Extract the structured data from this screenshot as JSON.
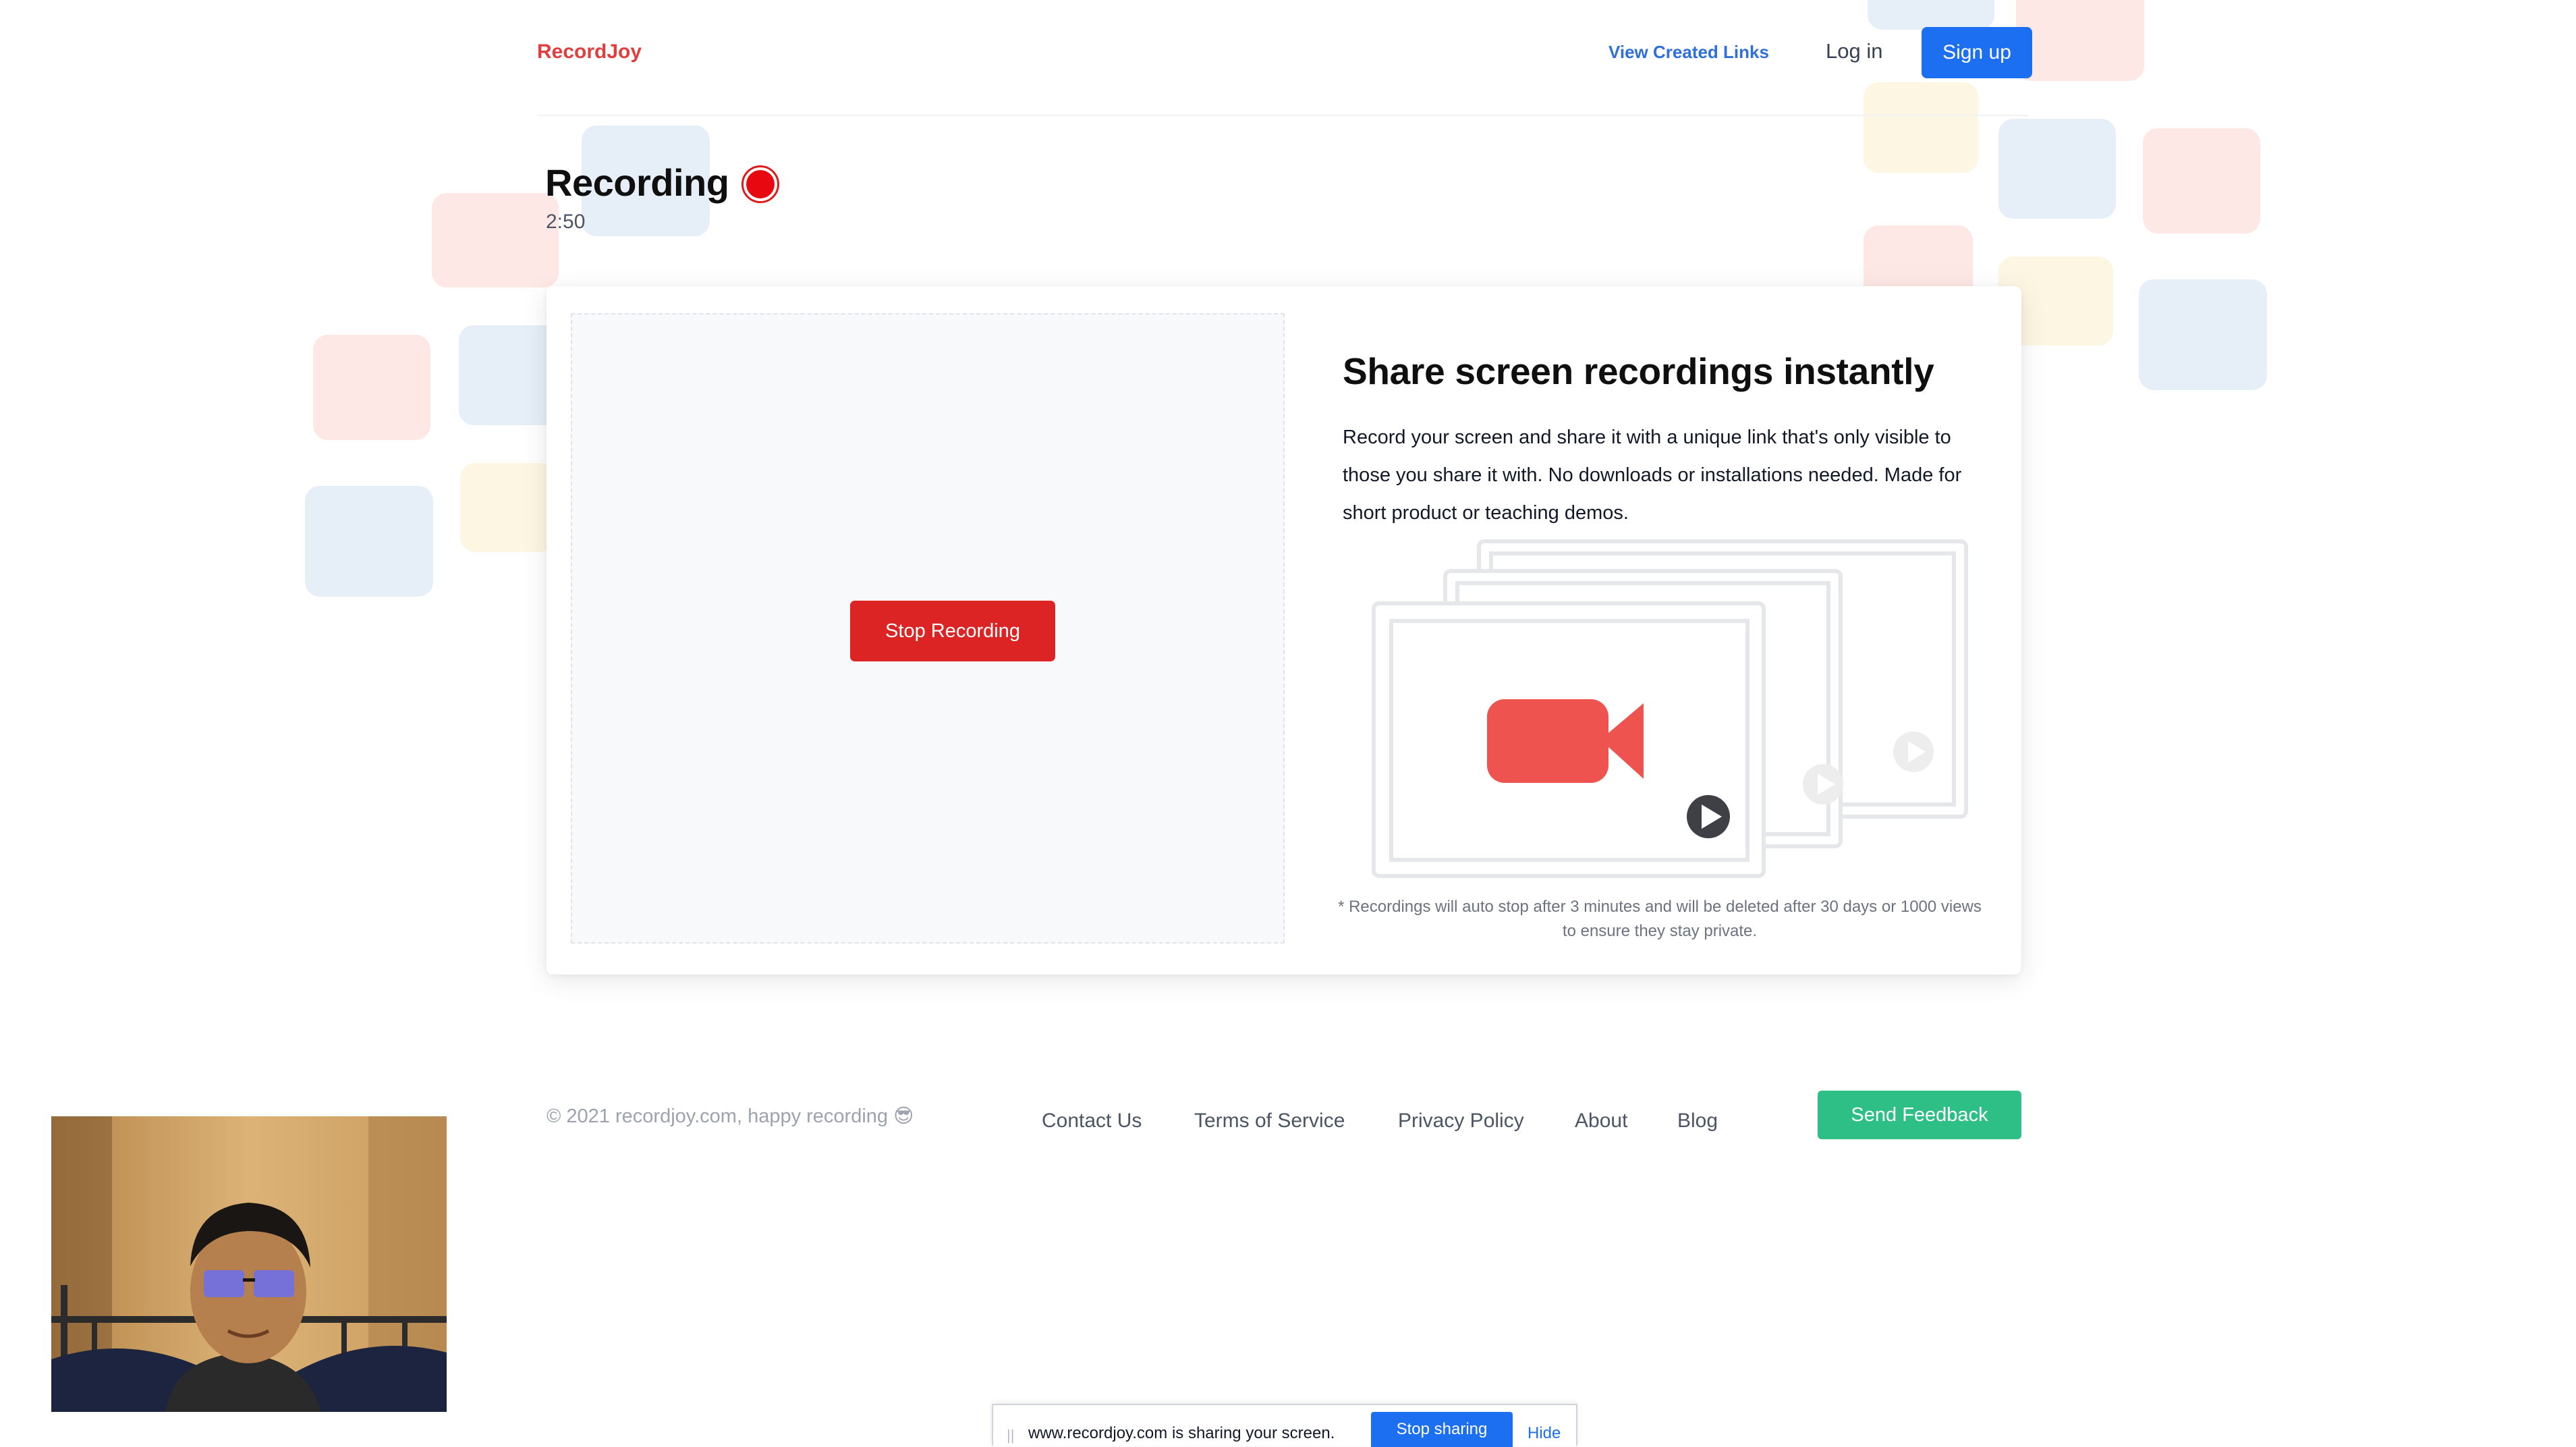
{
  "header": {
    "logo": "RecordJoy",
    "view_links_label": "View Created Links",
    "login_label": "Log in",
    "signup_label": "Sign up"
  },
  "recording": {
    "title": "Recording",
    "elapsed": "2:50"
  },
  "card": {
    "stop_recording_label": "Stop Recording",
    "heading": "Share screen recordings instantly",
    "description": "Record your screen and share it with a unique link that's only visible to those you share it with. No downloads or installations needed. Made for short product or teaching demos.",
    "note": "* Recordings will auto stop after 3 minutes and will be deleted after 30 days or 1000 views to ensure they stay private."
  },
  "footer": {
    "copyright": "© 2021 recordjoy.com, happy recording 😎",
    "links": [
      "Contact Us",
      "Terms of Service",
      "Privacy Policy",
      "About",
      "Blog"
    ],
    "feedback_label": "Send Feedback"
  },
  "share_bar": {
    "message": "www.recordjoy.com is sharing your screen.",
    "stop_label": "Stop sharing",
    "hide_label": "Hide"
  },
  "colors": {
    "brand_red": "#e03e3e",
    "primary_blue": "#1d6ff2",
    "stop_red": "#dd2424",
    "feedback_green": "#2dbf85",
    "camera_icon": "#ef5350"
  },
  "icons": [
    "recording-indicator-icon",
    "video-camera-icon",
    "play-icon"
  ]
}
